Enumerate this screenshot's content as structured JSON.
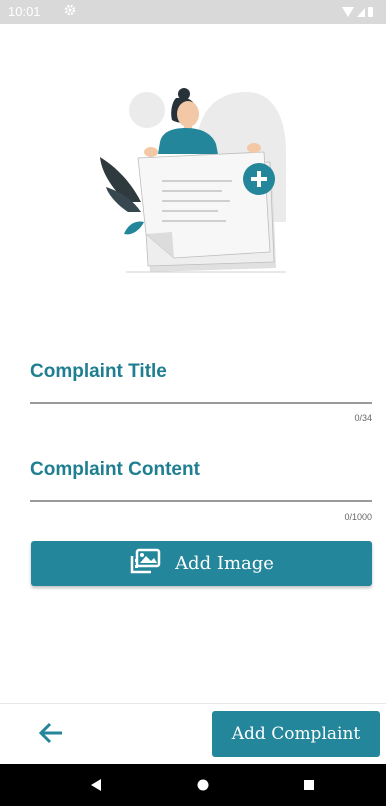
{
  "status_bar": {
    "time": "10:01"
  },
  "form": {
    "title_label": "Complaint Title",
    "title_counter": "0/34",
    "content_label": "Complaint Content",
    "content_counter": "0/1000"
  },
  "buttons": {
    "add_image": "Add Image",
    "add_complaint": "Add Complaint"
  },
  "icons": {
    "status": [
      "gear-icon",
      "wifi-icon",
      "signal-icon",
      "battery-icon"
    ],
    "add_image": "image-gallery-icon",
    "back": "arrow-left-icon",
    "nav": [
      "back-triangle-icon",
      "home-circle-icon",
      "recents-square-icon"
    ]
  },
  "colors": {
    "primary": "#23869a",
    "label": "#1f7f91",
    "status_bar": "#d9d9d9",
    "nav_bar": "#000000"
  }
}
